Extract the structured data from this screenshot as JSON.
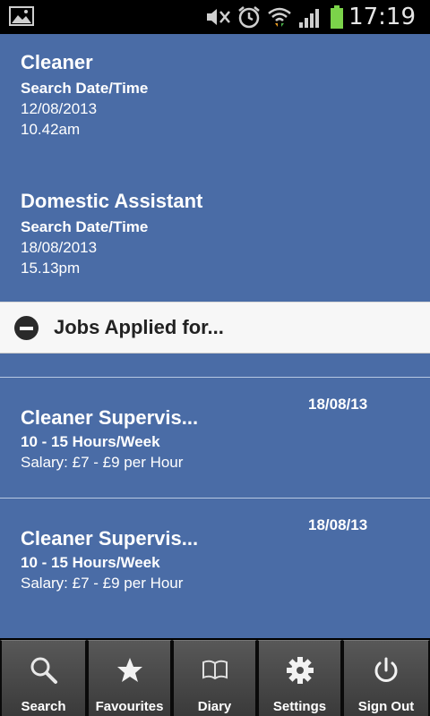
{
  "status_bar": {
    "time": "17:19"
  },
  "searches": [
    {
      "title": "Cleaner",
      "label": "Search Date/Time",
      "date": "12/08/2013",
      "time": "10.42am"
    },
    {
      "title": "Domestic Assistant",
      "label": "Search Date/Time",
      "date": "18/08/2013",
      "time": "15.13pm"
    }
  ],
  "section": {
    "title": "Jobs Applied for..."
  },
  "jobs": [
    {
      "title": "Cleaner Supervis...",
      "hours": "10 - 15 Hours/Week",
      "salary": "Salary: £7 - £9 per Hour",
      "date": "18/08/13"
    },
    {
      "title": "Cleaner Supervis...",
      "hours": "10 - 15 Hours/Week",
      "salary": "Salary: £7 - £9 per Hour",
      "date": "18/08/13"
    }
  ],
  "nav": [
    {
      "label": "Search",
      "icon": "search-icon"
    },
    {
      "label": "Favourites",
      "icon": "star-icon"
    },
    {
      "label": "Diary",
      "icon": "book-icon"
    },
    {
      "label": "Settings",
      "icon": "gear-icon"
    },
    {
      "label": "Sign Out",
      "icon": "power-icon"
    }
  ]
}
